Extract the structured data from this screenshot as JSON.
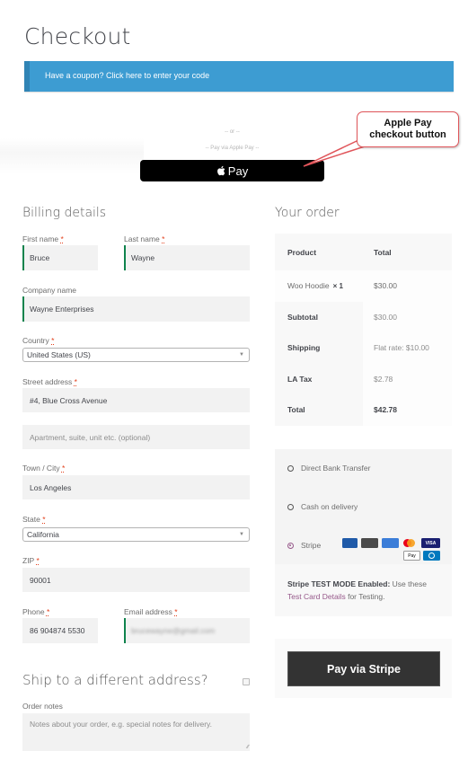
{
  "page": {
    "title": "Checkout"
  },
  "coupon": {
    "text": "Have a coupon? Click here to enter your code"
  },
  "express": {
    "or_text": "-- or --",
    "apple_pay_hint": "-- Pay via Apple Pay --",
    "apple_pay_button": "Pay",
    "apple_icon": ""
  },
  "annotation": {
    "line1": "Apple Pay",
    "line2": "checkout button"
  },
  "billing": {
    "title": "Billing details",
    "required_mark": "*",
    "fields": {
      "first_name": {
        "label": "First name",
        "value": "Bruce"
      },
      "last_name": {
        "label": "Last name",
        "value": "Wayne"
      },
      "company": {
        "label": "Company name",
        "value": "Wayne Enterprises"
      },
      "country": {
        "label": "Country",
        "value": "United States (US)"
      },
      "street": {
        "label": "Street address",
        "value": "#4, Blue Cross Avenue"
      },
      "street2": {
        "placeholder": "Apartment, suite, unit etc. (optional)"
      },
      "city": {
        "label": "Town / City",
        "value": "Los Angeles"
      },
      "state": {
        "label": "State",
        "value": "California"
      },
      "zip": {
        "label": "ZIP",
        "value": "90001"
      },
      "phone": {
        "label": "Phone",
        "value": "86 904874 5530"
      },
      "email": {
        "label": "Email address",
        "value": "brucewayne@gmail.com"
      }
    }
  },
  "shipping": {
    "title": "Ship to a different address?",
    "checked": false
  },
  "notes": {
    "label": "Order notes",
    "placeholder": "Notes about your order, e.g. special notes for delivery."
  },
  "order": {
    "title": "Your order",
    "headers": {
      "product": "Product",
      "total": "Total"
    },
    "items": [
      {
        "name": "Woo Hoodie",
        "qty": "× 1",
        "total": "$30.00"
      }
    ],
    "rows": [
      {
        "label": "Subtotal",
        "value": "$30.00"
      },
      {
        "label": "Shipping",
        "value": "Flat rate: $10.00"
      },
      {
        "label": "LA Tax",
        "value": "$2.78"
      },
      {
        "label": "Total",
        "value": "$42.78"
      }
    ]
  },
  "payment": {
    "methods": [
      {
        "label": "Direct Bank Transfer",
        "selected": false
      },
      {
        "label": "Cash on delivery",
        "selected": false
      },
      {
        "label": "Stripe",
        "selected": true
      }
    ],
    "cards": [
      "JCB",
      "DISCOVER",
      "AMEX",
      "MC",
      "VISA",
      "Pay",
      "Diners"
    ],
    "stripe_notice": {
      "bold": "Stripe TEST MODE Enabled:",
      "text1": " Use these",
      "link": "Test Card Details",
      "text2": " for Testing."
    },
    "button": "Pay via Stripe"
  }
}
